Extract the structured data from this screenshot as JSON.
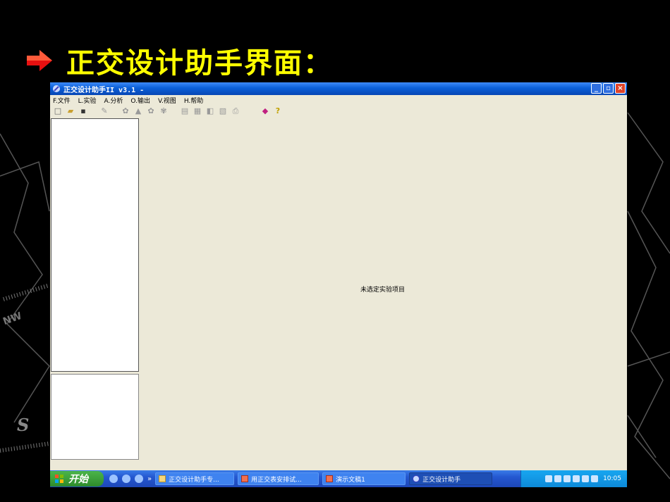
{
  "slide": {
    "title": "正交设计助手界面：",
    "deco_letters": {
      "nw": "NW",
      "s": "S"
    }
  },
  "window": {
    "title": "正交设计助手II v3.1 -",
    "buttons": {
      "minimize": "_",
      "maximize": "▫",
      "close": "×"
    }
  },
  "menu": [
    {
      "label": "F.文件"
    },
    {
      "label": "L.实验"
    },
    {
      "label": "A.分析"
    },
    {
      "label": "O.输出"
    },
    {
      "label": "V.视图"
    },
    {
      "label": "H.帮助"
    }
  ],
  "main": {
    "status_message": "未选定实验项目"
  },
  "taskbar": {
    "start_label": "开始",
    "more_label": "»",
    "tasks": [
      {
        "label": "正交设计助手专..."
      },
      {
        "label": "用正交表安排试..."
      },
      {
        "label": "演示文稿1"
      },
      {
        "label": "正交设计助手"
      }
    ],
    "clock": "10:05"
  },
  "colors": {
    "title_yellow": "#ffff00",
    "xp_blue": "#0a5fd8",
    "xp_gray": "#ece9d8"
  }
}
